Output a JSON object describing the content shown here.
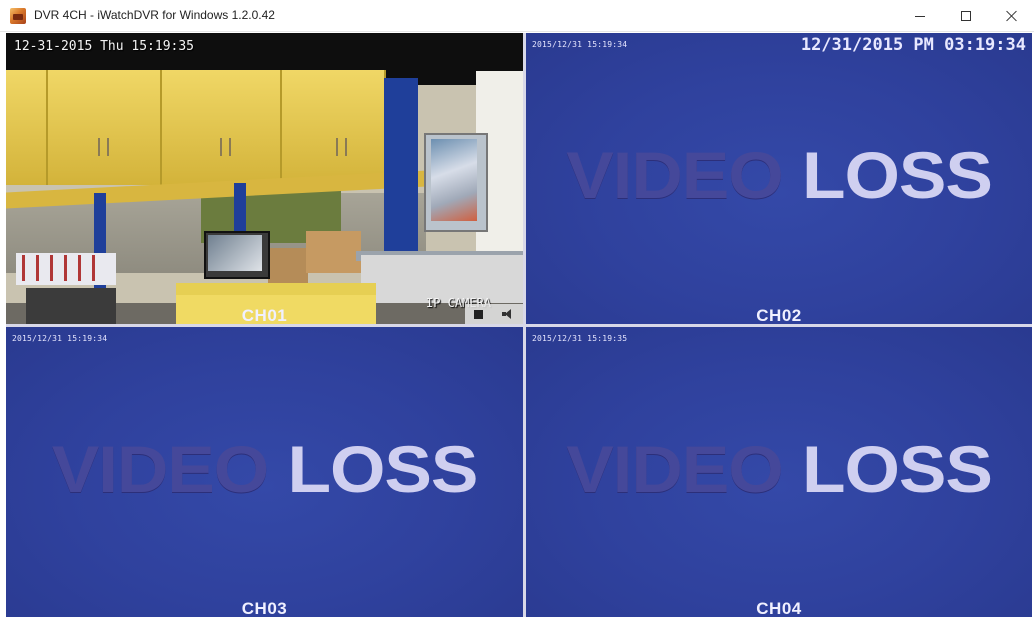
{
  "window": {
    "title": "DVR 4CH - iWatchDVR for Windows 1.2.0.42",
    "icon": "app-icon",
    "controls": {
      "minimize": "–",
      "maximize": "□",
      "close": "×"
    }
  },
  "channels": [
    {
      "id": "CH01",
      "label": "CH01",
      "status": "live",
      "overlay_timestamp": "12-31-2015 Thu 15:19:35",
      "camera_label": "IP CAMERA",
      "controls": [
        "stop-icon",
        "speaker-icon"
      ]
    },
    {
      "id": "CH02",
      "label": "CH02",
      "status": "video-loss",
      "timestamp": "2015/12/31 15:19:34",
      "clock": "12/31/2015 PM 03:19:34",
      "message": {
        "word1": "VIDEO",
        "word2": "LOSS"
      }
    },
    {
      "id": "CH03",
      "label": "CH03",
      "status": "video-loss",
      "timestamp": "2015/12/31 15:19:34",
      "message": {
        "word1": "VIDEO",
        "word2": "LOSS"
      }
    },
    {
      "id": "CH04",
      "label": "CH04",
      "status": "video-loss",
      "timestamp": "2015/12/31 15:19:35",
      "message": {
        "word1": "VIDEO",
        "word2": "LOSS"
      }
    }
  ],
  "colors": {
    "video_loss_bg": "#2e3f9a",
    "video_text_dark": "#45489a",
    "video_text_light": "#cfcff0"
  }
}
